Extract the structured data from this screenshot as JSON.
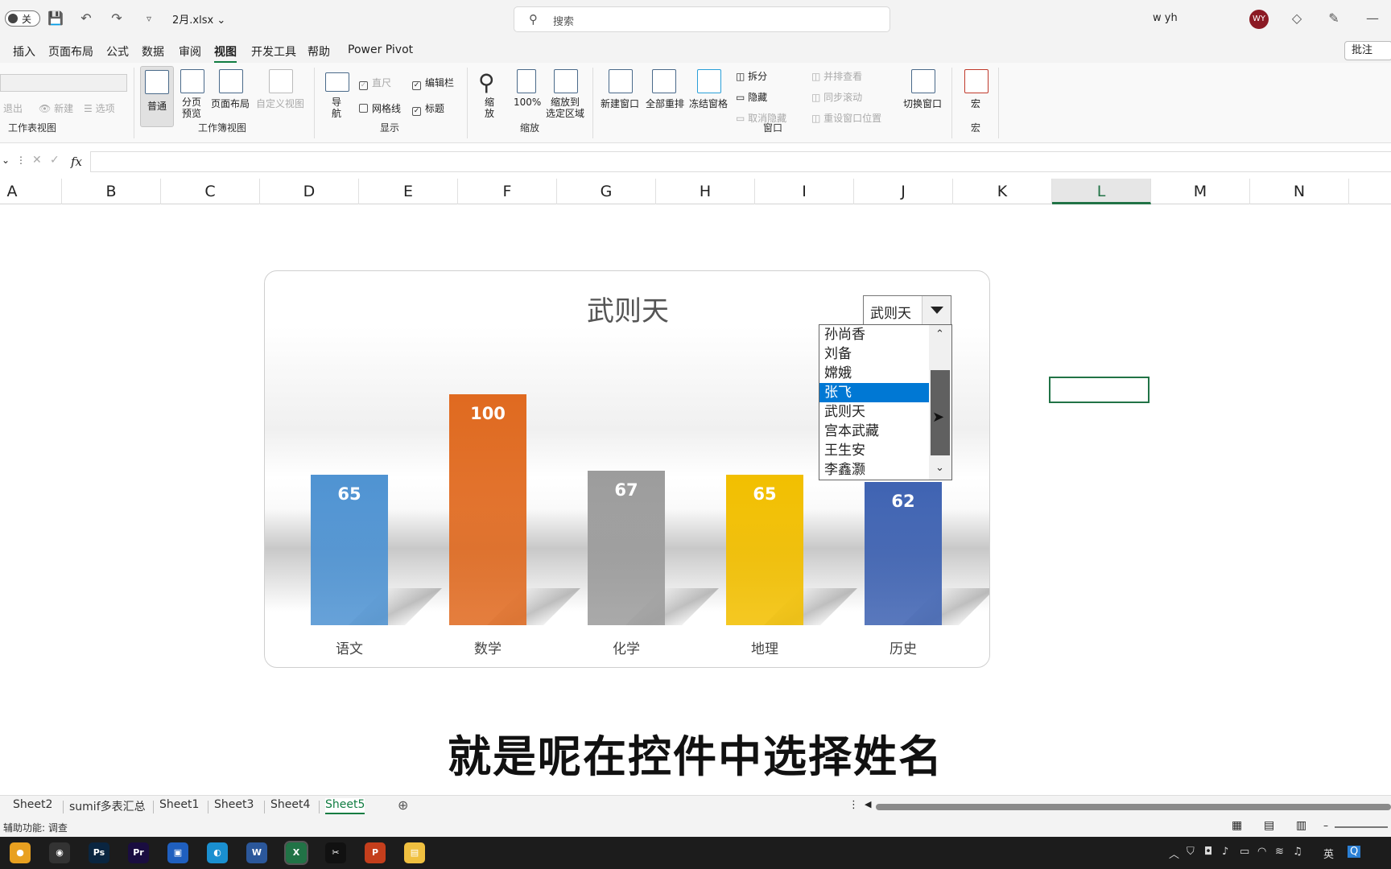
{
  "titlebar": {
    "autosave_label": "关",
    "filename": "2月.xlsx",
    "search_placeholder": "搜索",
    "user_name": "w yh",
    "avatar_initials": "WY"
  },
  "menu": {
    "tabs": [
      "插入",
      "页面布局",
      "公式",
      "数据",
      "审阅",
      "视图",
      "开发工具",
      "帮助",
      "Power Pivot"
    ],
    "active": "视图",
    "comment_label": "批注"
  },
  "ribbon": {
    "sheet_view": {
      "exit": "退出",
      "new": "新建",
      "options": "选项",
      "group": "工作表视图"
    },
    "workbook_views": {
      "normal": "普通",
      "page_break": "分页\n预览",
      "page_layout": "页面布局",
      "custom": "自定义视图",
      "group": "工作簿视图"
    },
    "show": {
      "nav": "导\n航",
      "ruler": "直尺",
      "formula_bar": "编辑栏",
      "gridlines": "网格线",
      "headings": "标题",
      "group": "显示"
    },
    "zoom": {
      "zoom": "缩\n放",
      "hundred": "100%",
      "to_selection": "缩放到\n选定区域",
      "group": "缩放"
    },
    "window": {
      "new_window": "新建窗口",
      "arrange_all": "全部重排",
      "freeze": "冻结窗格",
      "split": "拆分",
      "hide": "隐藏",
      "unhide": "取消隐藏",
      "side_by_side": "并排查看",
      "sync_scroll": "同步滚动",
      "reset_pos": "重设窗口位置",
      "switch": "切换窗口",
      "group": "窗口"
    },
    "macros": {
      "macro": "宏",
      "group": "宏"
    }
  },
  "formula_bar": {
    "fx": "fx"
  },
  "columns": [
    "A",
    "B",
    "C",
    "D",
    "E",
    "F",
    "G",
    "H",
    "I",
    "J",
    "K",
    "L",
    "M",
    "N"
  ],
  "selected_column": "L",
  "chart_data": {
    "type": "bar",
    "title": "武则天",
    "categories": [
      "语文",
      "数学",
      "化学",
      "地理",
      "历史"
    ],
    "values": [
      65,
      100,
      67,
      65,
      62
    ],
    "colors": [
      "#4f93d2",
      "#e06a20",
      "#9c9c9c",
      "#f2bf00",
      "#3f63b2"
    ],
    "ylim": [
      0,
      100
    ],
    "legend": "none",
    "grid": false
  },
  "combobox": {
    "value": "武则天",
    "options": [
      "孙尚香",
      "刘备",
      "嫦娥",
      "张飞",
      "武则天",
      "宫本武藏",
      "王生安",
      "李鑫灏"
    ],
    "highlighted": "张飞"
  },
  "caption": "就是呢在控件中选择姓名",
  "sheets": [
    "Sheet2",
    "sumif多表汇总",
    "Sheet1",
    "Sheet3",
    "Sheet4",
    "Sheet5"
  ],
  "active_sheet": "Sheet5",
  "status": "辅助功能: 调查",
  "taskbar": {
    "apps": [
      "chrome-icon",
      "obs-icon",
      "photoshop-icon",
      "premiere-icon",
      "zoom-icon",
      "browser-icon",
      "word-icon",
      "excel-icon",
      "capcut-icon",
      "powerpoint-icon",
      "explorer-icon"
    ],
    "ime": "英"
  }
}
